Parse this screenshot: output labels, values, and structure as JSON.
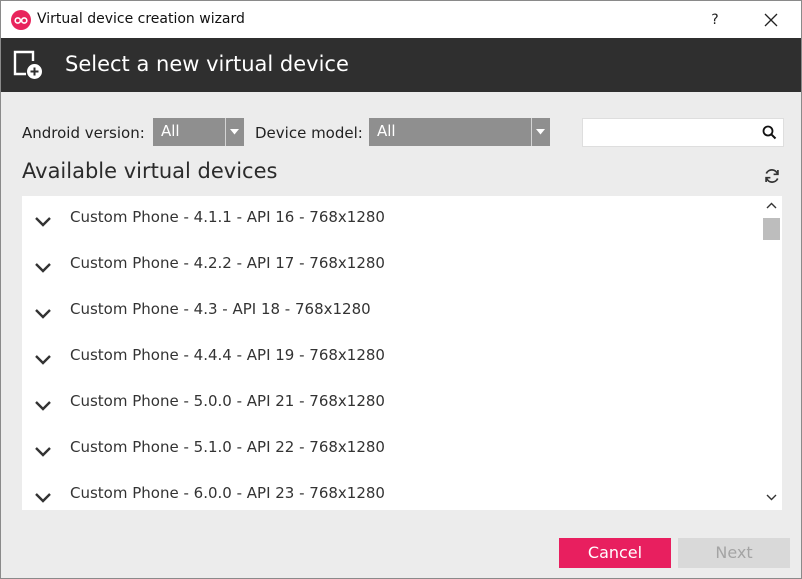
{
  "window": {
    "title": "Virtual device creation wizard",
    "help_label": "?",
    "accent_color": "#e81f5f"
  },
  "header": {
    "title": "Select a new virtual device",
    "icon": "add-device-icon"
  },
  "filters": {
    "android_version_label": "Android version:",
    "android_version_value": "All",
    "device_model_label": "Device model:",
    "device_model_value": "All",
    "search_placeholder": "",
    "search_icon": "search-icon"
  },
  "devices": {
    "title": "Available virtual devices",
    "refresh_icon": "refresh-icon",
    "items": [
      {
        "label": "Custom Phone - 4.1.1 - API 16 - 768x1280"
      },
      {
        "label": "Custom Phone - 4.2.2 - API 17 - 768x1280"
      },
      {
        "label": "Custom Phone - 4.3 - API 18 - 768x1280"
      },
      {
        "label": "Custom Phone - 4.4.4 - API 19 - 768x1280"
      },
      {
        "label": "Custom Phone - 5.0.0 - API 21 - 768x1280"
      },
      {
        "label": "Custom Phone - 5.1.0 - API 22 - 768x1280"
      },
      {
        "label": "Custom Phone - 6.0.0 - API 23 - 768x1280"
      }
    ]
  },
  "footer": {
    "cancel_label": "Cancel",
    "next_label": "Next"
  }
}
